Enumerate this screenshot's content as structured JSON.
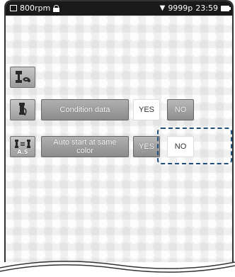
{
  "status_bar": {
    "speed": "800rpm",
    "stitch_count": "9999p",
    "time": "23:59"
  },
  "rows": {
    "row1": {
      "icon": "spool-icon"
    },
    "row2": {
      "icon": "thread-icon",
      "label": "Condition data",
      "yes": "YES",
      "no": "NO"
    },
    "row3": {
      "icon": "auto-start-icon",
      "icon_text": "A.S",
      "label": "Auto start at same color",
      "yes": "YES",
      "no": "NO"
    }
  }
}
